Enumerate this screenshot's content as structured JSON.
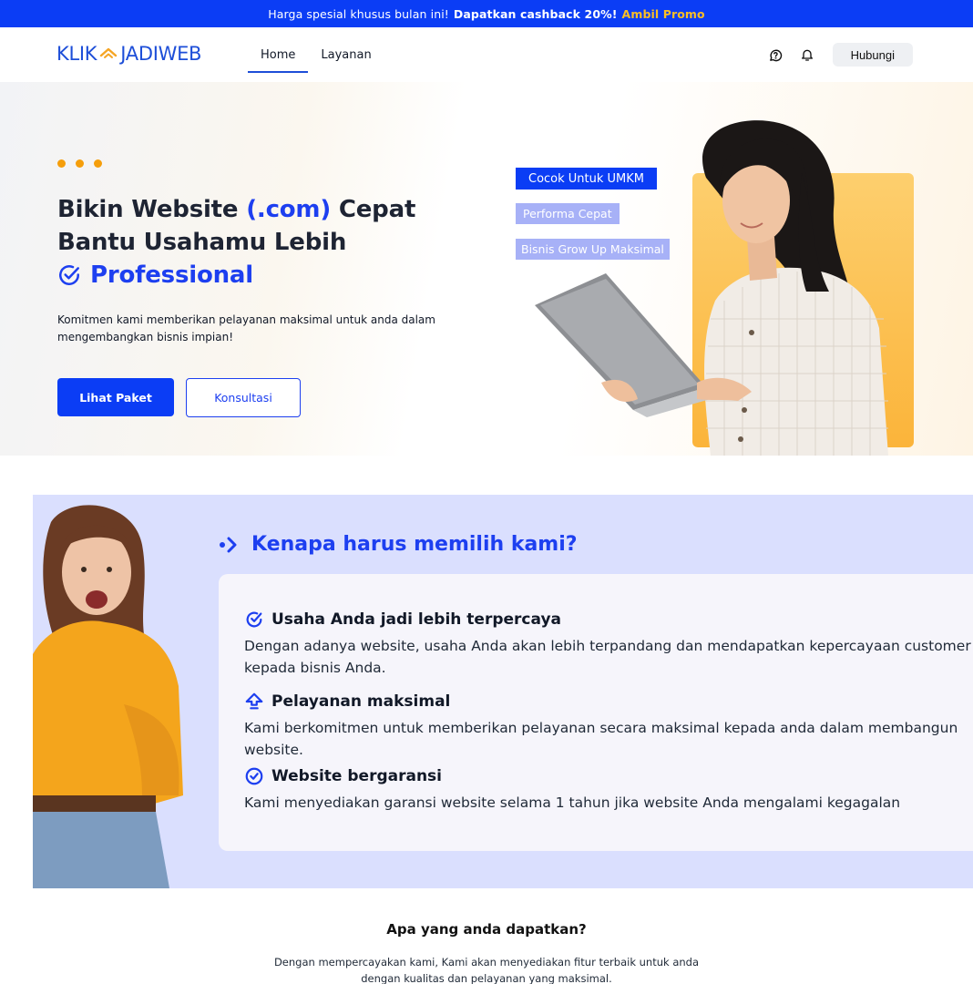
{
  "promo": {
    "text": "Harga spesial khusus bulan ini!",
    "highlight": "Dapatkan cashback 20%!",
    "link": "Ambil Promo"
  },
  "navbar": {
    "logo_left": "KLIK",
    "logo_right": "JADIWEB",
    "links": [
      "Home",
      "Layanan"
    ],
    "contact_label": "Hubungi",
    "icons": [
      "chat-help-icon",
      "bell-icon"
    ]
  },
  "hero": {
    "title_part1": "Bikin Website ",
    "title_accent": "(.com)",
    "title_part2": " Cepat",
    "title_line2": "Bantu Usahamu Lebih",
    "title_line3": "Professional",
    "description": "Komitmen kami memberikan pelayanan maksimal untuk anda dalam mengembangkan bisnis impian!",
    "primary_button": "Lihat Paket",
    "secondary_button": "Konsultasi",
    "tags": [
      "Cocok Untuk UMKM",
      "Performa Cepat",
      "Bisnis Grow Up Maksimal"
    ]
  },
  "why": {
    "title": "Kenapa harus memilih kami?",
    "features": [
      {
        "icon": "check-circle-icon",
        "title": "Usaha Anda jadi lebih terpercaya",
        "text": "Dengan adanya website, usaha Anda akan lebih terpandang dan mendapatkan kepercayaan customer kepada bisnis Anda."
      },
      {
        "icon": "arrow-up-icon",
        "title": "Pelayanan maksimal",
        "text": "Kami berkomitmen untuk memberikan pelayanan secara maksimal kepada anda dalam membangun website."
      },
      {
        "icon": "badge-check-icon",
        "title": "Website bergaransi",
        "text": "Kami menyediakan garansi website selama 1 tahun jika website Anda mengalami kegagalan"
      }
    ]
  },
  "benefits": {
    "title": "Apa yang anda dapatkan?",
    "line1": "Dengan mempercayakan kami, Kami akan menyediakan fitur terbaik untuk anda",
    "line2": "dengan kualitas dan pelayanan yang maksimal."
  },
  "colors": {
    "brand_blue": "#0b3df5",
    "accent_orange": "#f59e0b",
    "section_bg": "#dadffe"
  }
}
